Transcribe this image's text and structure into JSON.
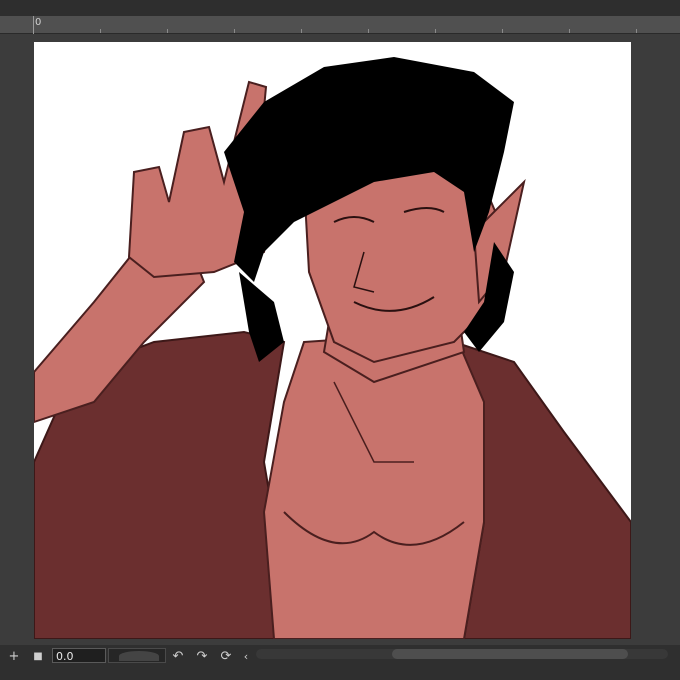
{
  "ruler": {
    "origin_label": "0"
  },
  "timeline": {
    "add_icon_glyph": "+",
    "stop_icon_glyph": "■",
    "time_value": "0.0",
    "undo_glyph": "↶",
    "redo_glyph": "↷",
    "loop_glyph": "⟳",
    "collapse_glyph": "‹"
  },
  "colors": {
    "skin": "#c8736c",
    "shirt": "#6b2f2f",
    "hair": "#000000",
    "line": "#4a1f1f",
    "canvas_bg": "#ffffff",
    "workspace_bg": "#3c3c3c"
  }
}
